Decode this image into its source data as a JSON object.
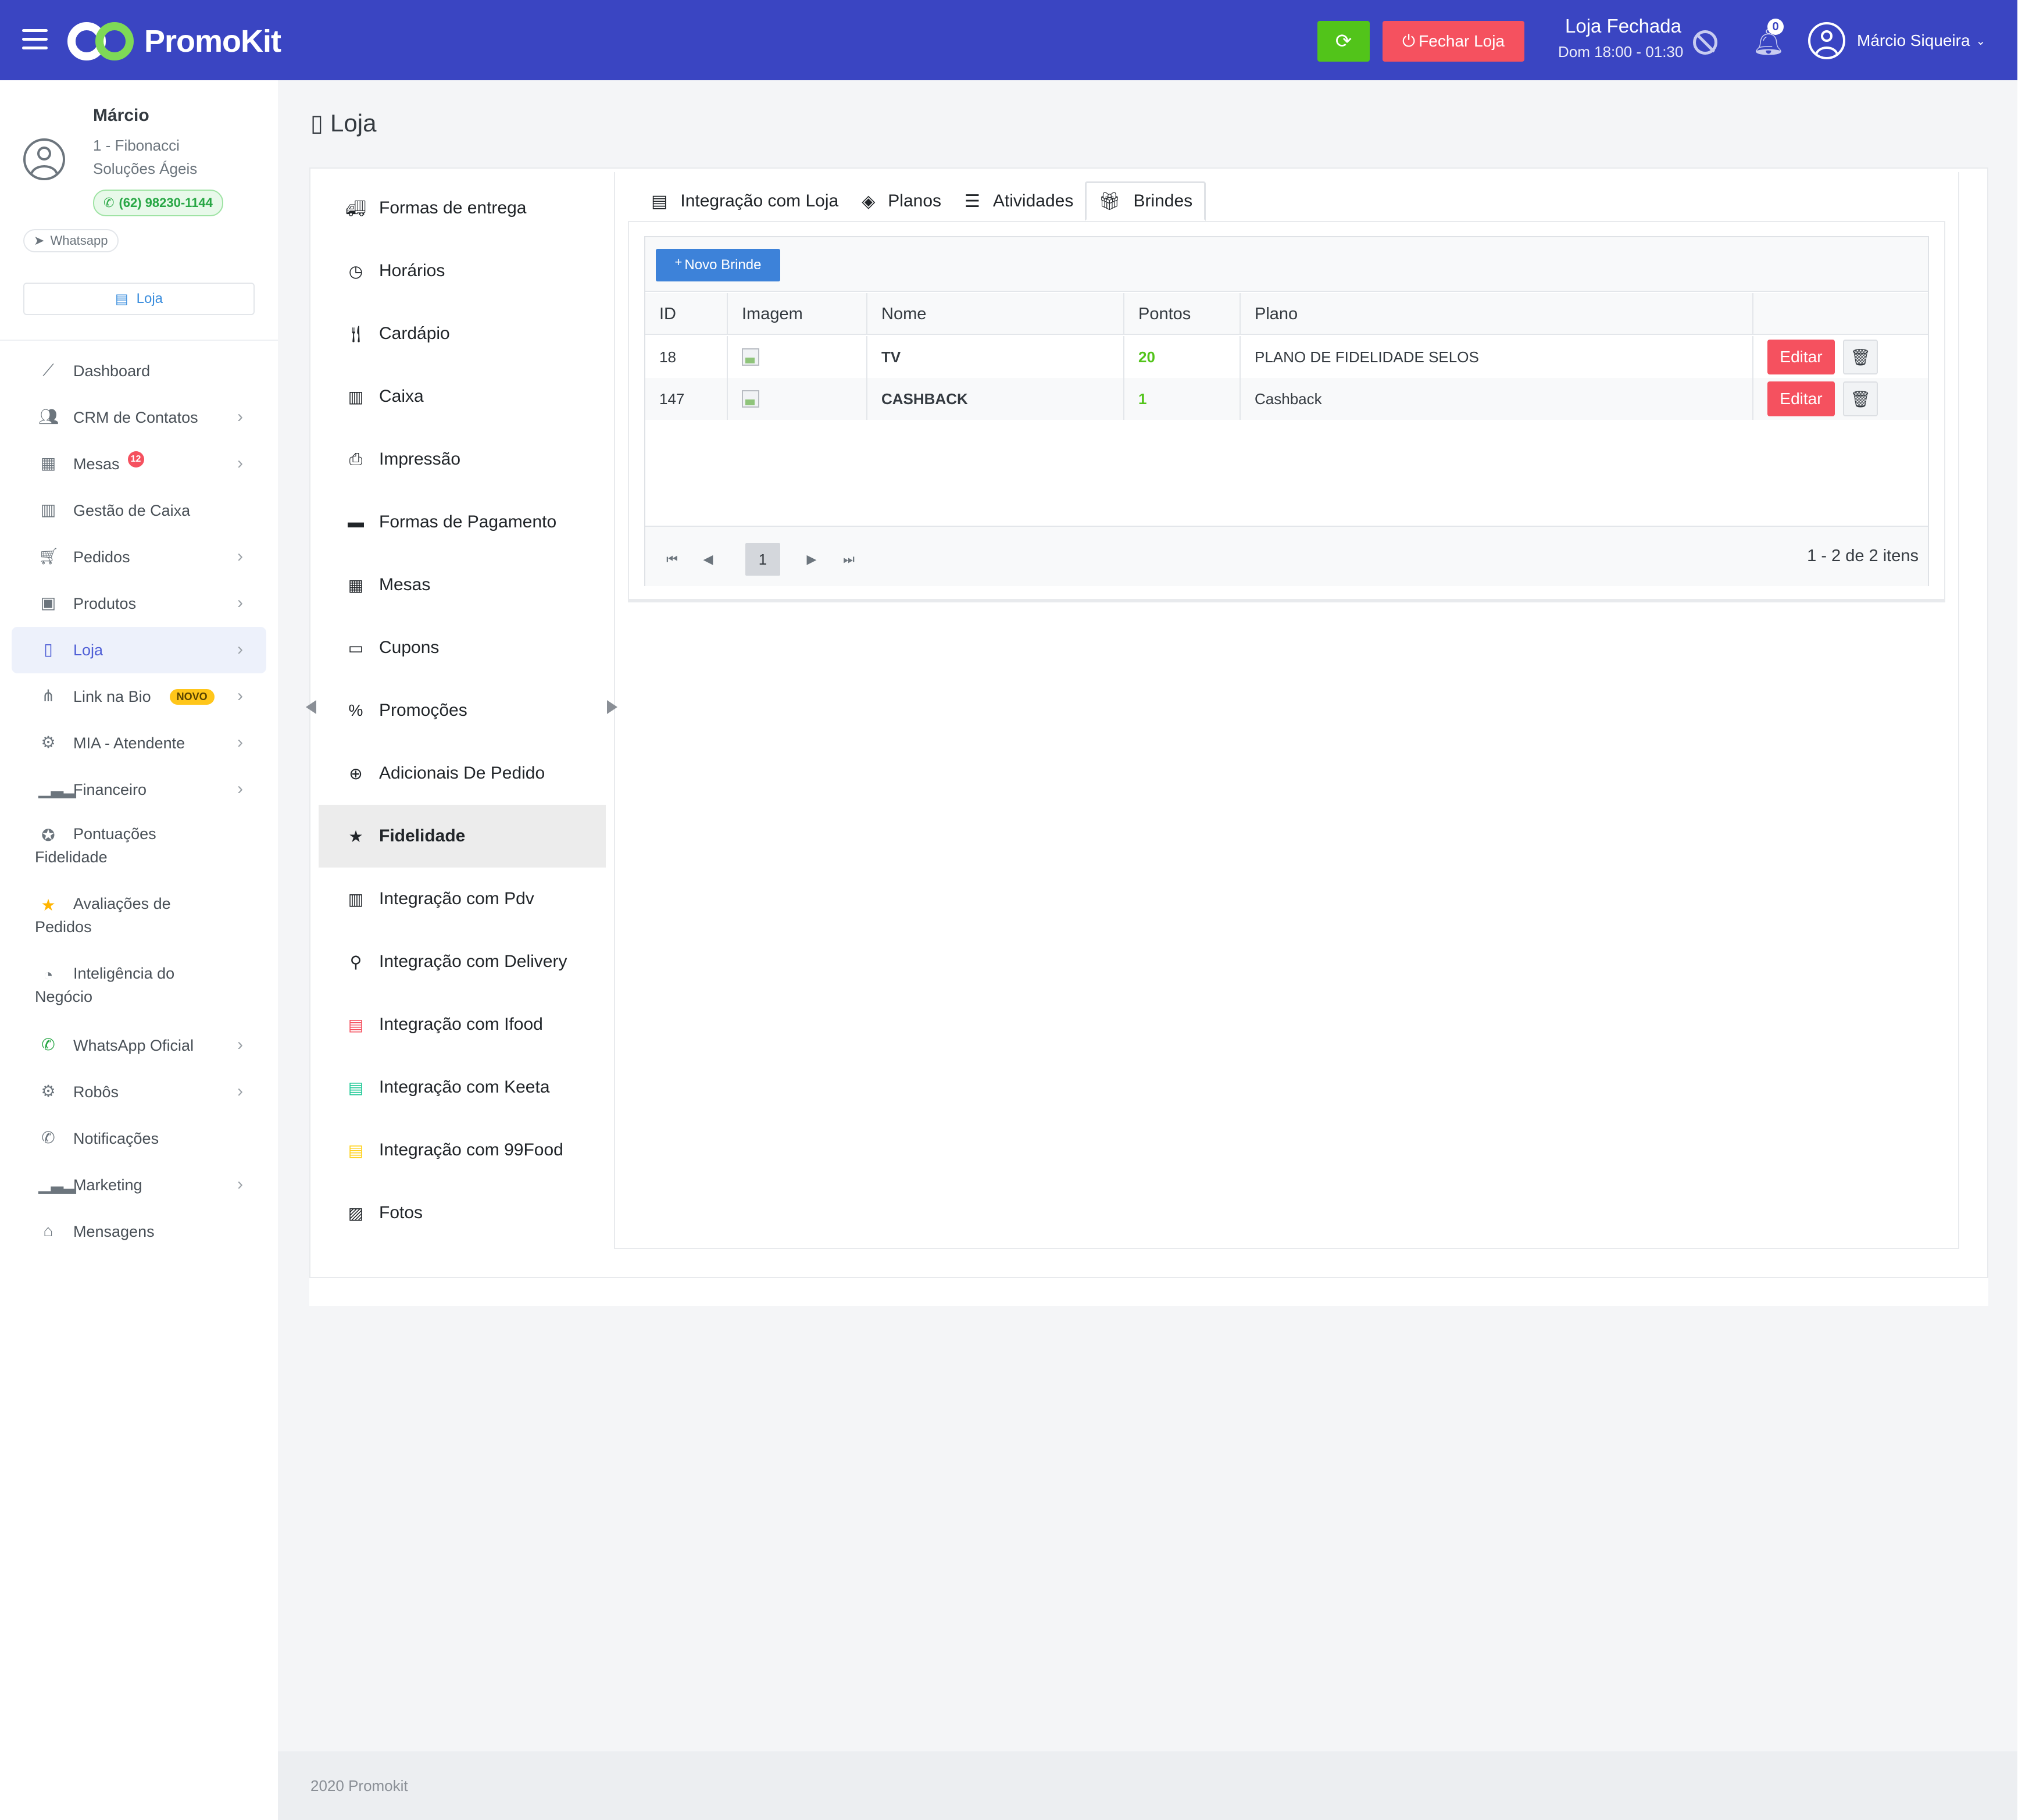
{
  "app": {
    "logo_text": "PromoKit",
    "brand_color": "#3a45c2"
  },
  "topbar": {
    "refresh_icon": "refresh-icon",
    "close_store_label": "Fechar Loja",
    "store_status": "Loja Fechada",
    "store_hours": "Dom 18:00 - 01:30",
    "notification_count": "0",
    "user_name": "Márcio Siqueira"
  },
  "profile": {
    "name": "Márcio",
    "company": "1 - Fibonacci Soluções Ágeis",
    "phone": "(62) 98230-1144",
    "whatsapp_label": "Whatsapp",
    "store_label": "Loja"
  },
  "sidebar": {
    "items": [
      {
        "label": "Dashboard",
        "icon": "chart-line-icon"
      },
      {
        "label": "CRM de Contatos",
        "icon": "users-icon"
      },
      {
        "label": "Mesas",
        "icon": "table-icon",
        "badge": "12"
      },
      {
        "label": "Gestão de Caixa",
        "icon": "cash-register-icon"
      },
      {
        "label": "Pedidos",
        "icon": "cart-icon"
      },
      {
        "label": "Produtos",
        "icon": "boxes-icon"
      },
      {
        "label": "Loja",
        "icon": "building-icon"
      },
      {
        "label": "Link na Bio",
        "icon": "sitemap-icon",
        "badge": "NOVO"
      },
      {
        "label": "MIA - Atendente",
        "icon": "robot-icon"
      },
      {
        "label": "Financeiro",
        "icon": "bar-chart-icon"
      },
      {
        "label_line1": "Pontuações",
        "label_line2": "Fidelidade",
        "icon": "medal-icon"
      },
      {
        "label_line1": "Avaliações de",
        "label_line2": "Pedidos",
        "icon": "star-icon"
      },
      {
        "label_line1": "Inteligência do",
        "label_line2": "Negócio",
        "icon": "pie-chart-icon"
      },
      {
        "label": "WhatsApp Oficial",
        "icon": "whatsapp-icon"
      },
      {
        "label": "Robôs",
        "icon": "robot-icon"
      },
      {
        "label": "Notificações",
        "icon": "whatsapp-icon"
      },
      {
        "label": "Marketing",
        "icon": "bar-chart-icon"
      },
      {
        "label": "Mensagens",
        "icon": "inbox-icon"
      }
    ]
  },
  "page": {
    "title": "Loja"
  },
  "settings_nav": {
    "items": [
      "Formas de entrega",
      "Horários",
      "Cardápio",
      "Caixa",
      "Impressão",
      "Formas de Pagamento",
      "Mesas",
      "Cupons",
      "Promoções",
      "Adicionais De Pedido",
      "Fidelidade",
      "Integração com Pdv",
      "Integração com Delivery",
      "Integração com Ifood",
      "Integração com Keeta",
      "Integração com 99Food",
      "Fotos"
    ]
  },
  "tabs": [
    "Integração com Loja",
    "Planos",
    "Atividades",
    "Brindes"
  ],
  "grid": {
    "new_button": "Novo Brinde",
    "columns": [
      "ID",
      "Imagem",
      "Nome",
      "Pontos",
      "Plano"
    ],
    "rows": [
      {
        "id": "18",
        "name": "TV",
        "points": "20",
        "plan": "PLANO DE FIDELIDADE SELOS"
      },
      {
        "id": "147",
        "name": "CASHBACK",
        "points": "1",
        "plan": "Cashback"
      }
    ],
    "edit_label": "Editar",
    "current_page": "1",
    "pager_info": "1 - 2 de 2 itens"
  },
  "footer": {
    "text": "2020 Promokit"
  }
}
